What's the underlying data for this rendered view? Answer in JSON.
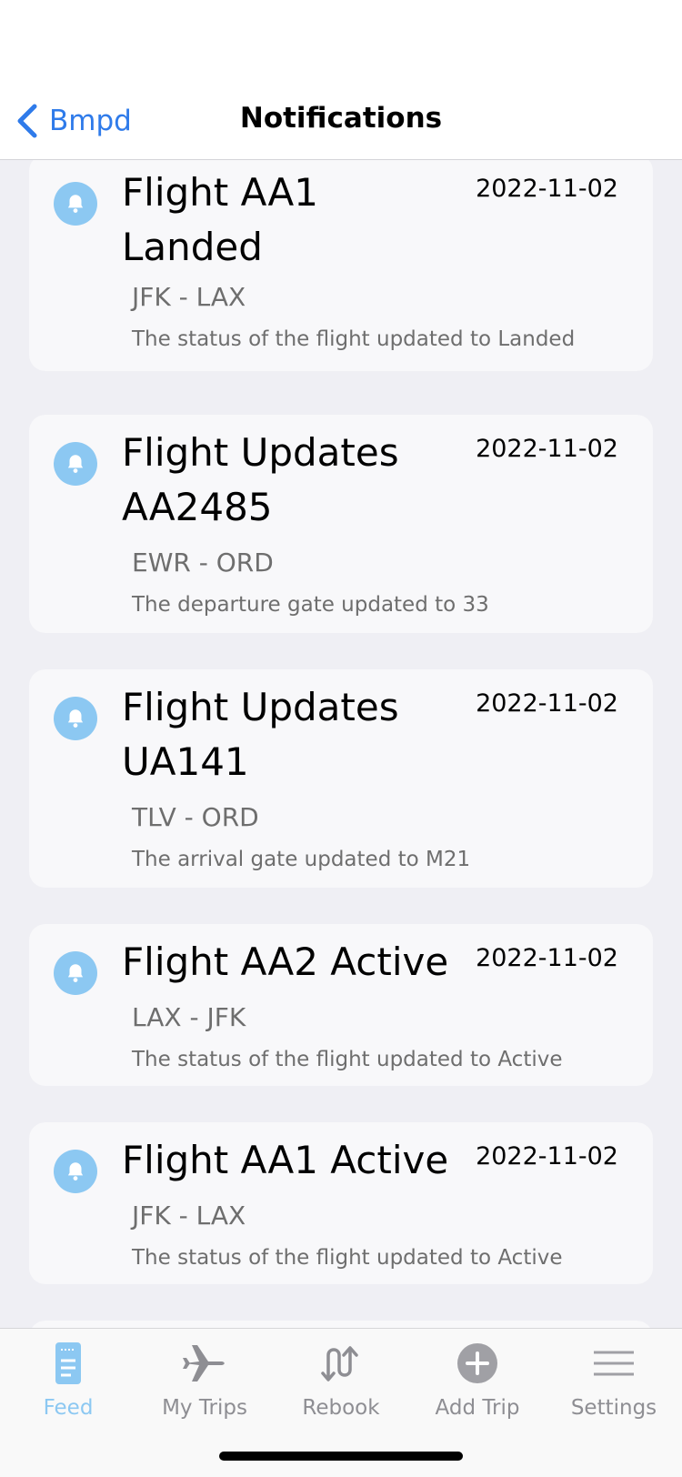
{
  "nav": {
    "back_label": "Bmpd",
    "title": "Notifications"
  },
  "notifications": [
    {
      "title": "Flight AA1 Landed",
      "date": "2022-11-02",
      "route": "JFK - LAX",
      "description": "The status of the flight updated to Landed",
      "icon": "bell-icon"
    },
    {
      "title": "Flight Updates AA2485",
      "date": "2022-11-02",
      "route": "EWR - ORD",
      "description": "The departure gate updated to 33",
      "icon": "bell-icon"
    },
    {
      "title": "Flight Updates UA141",
      "date": "2022-11-02",
      "route": "TLV - ORD",
      "description": "The arrival gate updated to M21",
      "icon": "bell-icon"
    },
    {
      "title": "Flight AA2 Active",
      "date": "2022-11-02",
      "route": "LAX - JFK",
      "description": "The status of the flight updated to Active",
      "icon": "bell-icon"
    },
    {
      "title": "Flight AA1 Active",
      "date": "2022-11-02",
      "route": "JFK - LAX",
      "description": "The status of the flight updated to Active",
      "icon": "bell-icon"
    }
  ],
  "tabbar": {
    "tabs": [
      {
        "label": "Feed",
        "icon": "feed-icon",
        "active": true
      },
      {
        "label": "My Trips",
        "icon": "airplane-icon",
        "active": false
      },
      {
        "label": "Rebook",
        "icon": "rebook-icon",
        "active": false
      },
      {
        "label": "Add Trip",
        "icon": "plus-circle-icon",
        "active": false
      },
      {
        "label": "Settings",
        "icon": "menu-lines-icon",
        "active": false
      }
    ]
  },
  "colors": {
    "accent": "#2f7bea",
    "bell_bg": "#8cc8f2",
    "active_tab": "#8cc8f2",
    "inactive_tab": "#8e8e93",
    "background": "#efeff4",
    "card": "#f8f8fa"
  }
}
